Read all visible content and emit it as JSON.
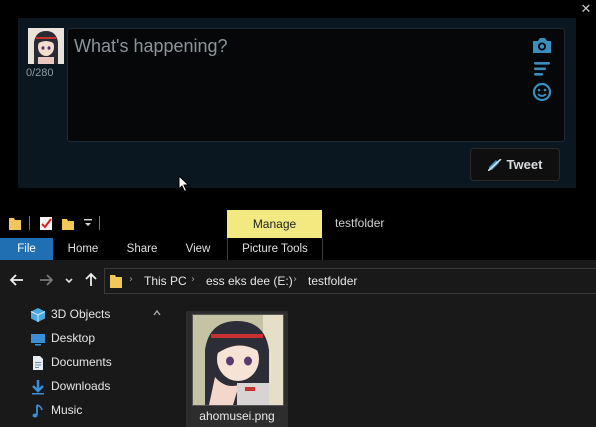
{
  "composer": {
    "placeholder": "What's happening?",
    "char_count": "0/280",
    "close_icon": "close-icon",
    "tools": [
      "camera-icon",
      "text-lines-icon",
      "emoji-icon"
    ],
    "tweet_label": "Tweet",
    "accent_color": "#3a8fbf"
  },
  "explorer": {
    "context_tab": "Manage",
    "window_title": "testfolder",
    "ribbon_tabs": {
      "file": "File",
      "home": "Home",
      "share": "Share",
      "view": "View",
      "picture_tools": "Picture Tools"
    },
    "breadcrumb": {
      "item1": "This PC",
      "item2": "ess eks dee (E:)",
      "item3": "testfolder"
    },
    "sidebar": {
      "objects3d": "3D Objects",
      "desktop": "Desktop",
      "documents": "Documents",
      "downloads": "Downloads",
      "music": "Music"
    },
    "files": {
      "file1": "ahomusei.png"
    },
    "accent_color": "#1f6fb2",
    "manage_color": "#f2ea80"
  }
}
